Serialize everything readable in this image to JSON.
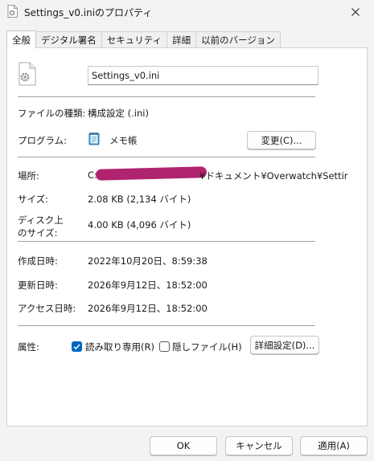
{
  "window": {
    "title": "Settings_v0.iniのプロパティ",
    "close_icon": "close-icon"
  },
  "tabs": [
    {
      "label": "全般",
      "active": true
    },
    {
      "label": "デジタル署名",
      "active": false
    },
    {
      "label": "セキュリティ",
      "active": false
    },
    {
      "label": "詳細",
      "active": false
    },
    {
      "label": "以前のバージョン",
      "active": false
    }
  ],
  "general": {
    "file_name": "Settings_v0.ini",
    "file_type_label": "ファイルの種類:",
    "file_type_value": "構成設定 (.ini)",
    "program_label": "プログラム:",
    "program_value": "メモ帳",
    "change_button": "変更(C)...",
    "location_label": "場所:",
    "location_start": "C:",
    "location_end": "¥ドキュメント¥Overwatch¥Settir",
    "size_label": "サイズ:",
    "size_value": "2.08 KB (2,134 バイト)",
    "disk_size_label_1": "ディスク上",
    "disk_size_label_2": "のサイズ:",
    "disk_size_value": "4.00 KB (4,096 バイト)",
    "created_label": "作成日時:",
    "created_value": "2022年10月20日、8:59:38",
    "modified_label": "更新日時:",
    "modified_value": "2026年9月12日、18:52:00",
    "accessed_label": "アクセス日時:",
    "accessed_value": "2026年9月12日、18:52:00",
    "attributes_label": "属性:",
    "readonly_label": "読み取り専用(R)",
    "readonly_checked": true,
    "hidden_label": "隠しファイル(H)",
    "hidden_checked": false,
    "advanced_button": "詳細設定(D)..."
  },
  "footer": {
    "ok": "OK",
    "cancel": "キャンセル",
    "apply": "適用(A)"
  },
  "colors": {
    "accent": "#0067c0",
    "redaction": "#b0236f"
  }
}
